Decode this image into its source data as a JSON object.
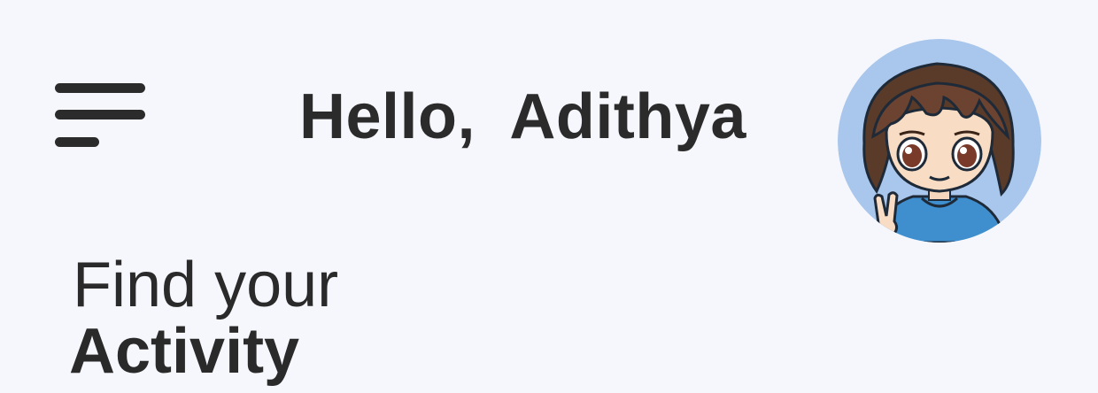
{
  "header": {
    "greeting_prefix": "Hello,",
    "user_name": "Adithya",
    "menu_icon": "hamburger-menu-icon",
    "avatar_icon": "user-avatar"
  },
  "hero": {
    "line1": "Find your",
    "line2": "Activity"
  },
  "colors": {
    "background": "#f6f7fc",
    "text": "#2a2a2a",
    "avatar_bg": "#a9c6ec"
  }
}
